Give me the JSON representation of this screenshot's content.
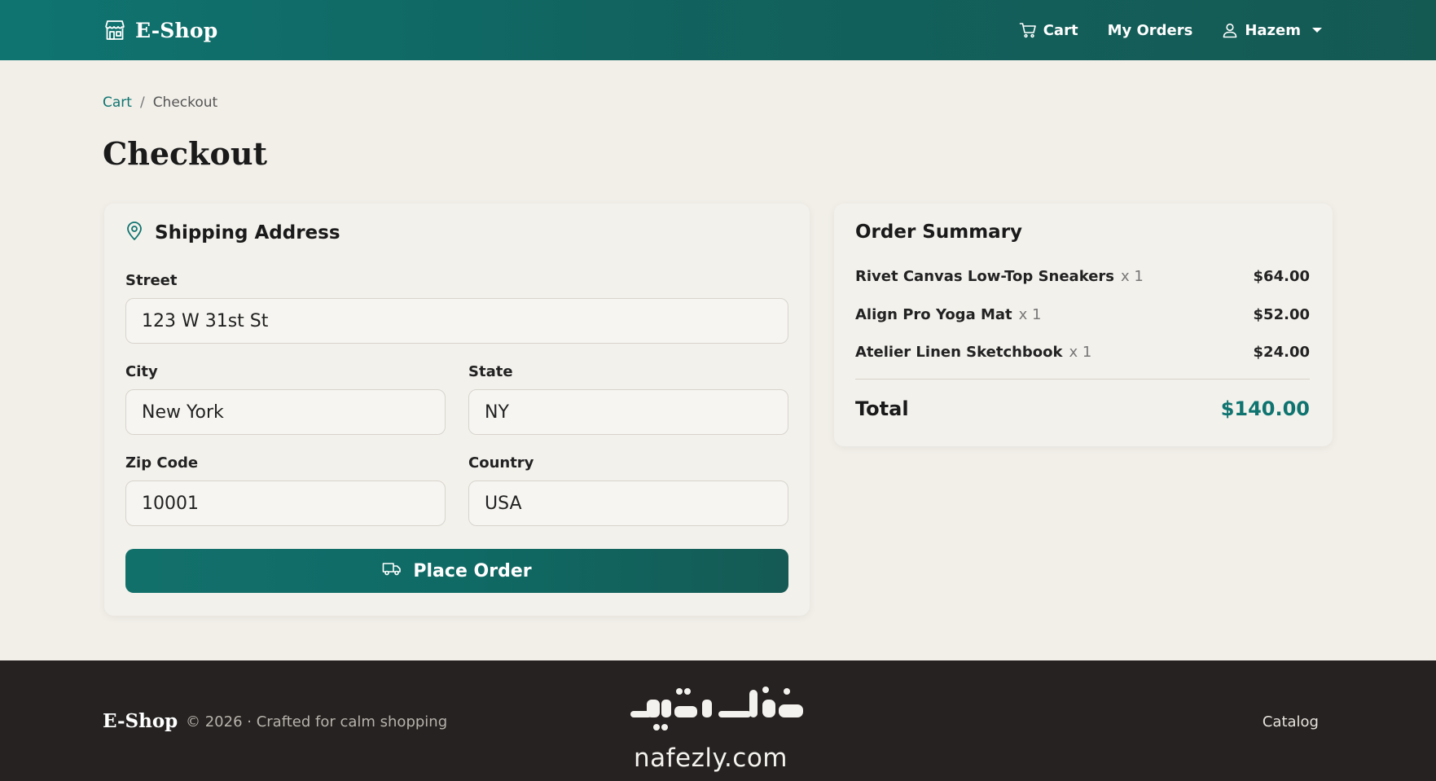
{
  "navbar": {
    "brand": "E-Shop",
    "cart_label": "Cart",
    "orders_label": "My Orders",
    "user_name": "Hazem"
  },
  "breadcrumb": {
    "items": [
      "Cart",
      "Checkout"
    ],
    "separator": "/"
  },
  "page": {
    "title": "Checkout"
  },
  "shipping": {
    "title": "Shipping Address",
    "fields": {
      "street": {
        "label": "Street",
        "value": "123 W 31st St"
      },
      "city": {
        "label": "City",
        "value": "New York"
      },
      "state": {
        "label": "State",
        "value": "NY"
      },
      "zip": {
        "label": "Zip Code",
        "value": "10001"
      },
      "country": {
        "label": "Country",
        "value": "USA"
      }
    },
    "submit_label": "Place Order"
  },
  "summary": {
    "title": "Order Summary",
    "items": [
      {
        "name": "Rivet Canvas Low-Top Sneakers",
        "qty": "x 1",
        "price": "$64.00"
      },
      {
        "name": "Align Pro Yoga Mat",
        "qty": "x 1",
        "price": "$52.00"
      },
      {
        "name": "Atelier Linen Sketchbook",
        "qty": "x 1",
        "price": "$24.00"
      }
    ],
    "total_label": "Total",
    "total_value": "$140.00"
  },
  "footer": {
    "brand": "E-Shop",
    "copyright": "© 2026  · Crafted for calm shopping",
    "catalog_link": "Catalog",
    "watermark": "نفذلي nafezly.com"
  },
  "colors": {
    "primary": "#0f7470",
    "primary_dark": "#155953",
    "page_bg": "#f2efe9",
    "footer_bg": "#252221",
    "total_accent": "#0f7470"
  },
  "icons": {
    "brand": "store-icon",
    "cart": "cart-icon",
    "user": "user-icon",
    "shipping": "map-pin-icon",
    "place_order": "truck-icon"
  }
}
